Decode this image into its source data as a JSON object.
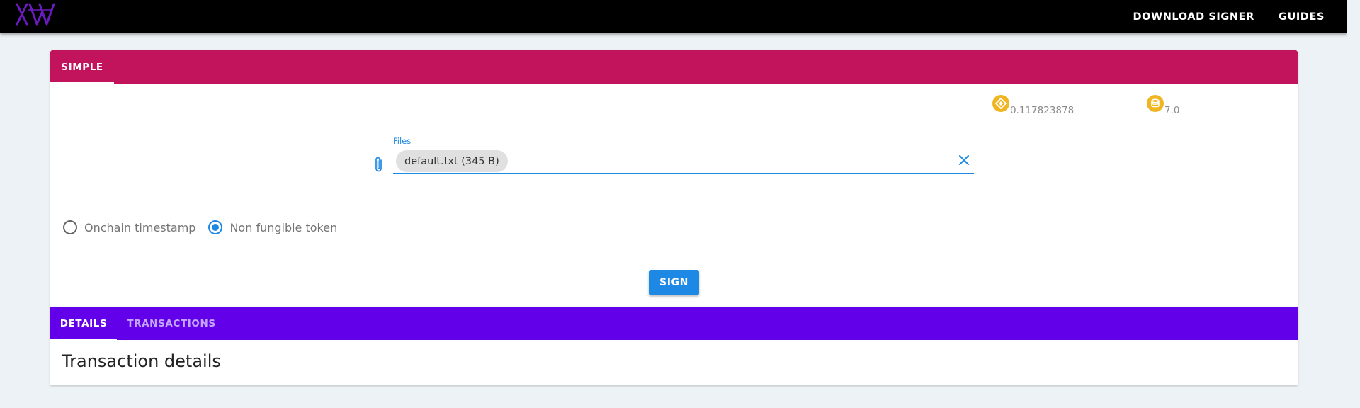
{
  "header": {
    "logo_text": "XV",
    "nav": {
      "download_signer": "DOWNLOAD SIGNER",
      "guides": "GUIDES"
    }
  },
  "top_card": {
    "tab_simple": "SIMPLE",
    "balances": [
      {
        "icon": "coin-diamond-icon",
        "value": "0.117823878"
      },
      {
        "icon": "coin-stack-icon",
        "value": "7.0"
      }
    ],
    "files": {
      "label": "Files",
      "chip": "default.txt (345 B)"
    },
    "radios": {
      "onchain": "Onchain timestamp",
      "nft": "Non fungible token",
      "selected": "nft"
    },
    "sign_button": "SIGN"
  },
  "bottom_card": {
    "tab_details": "DETAILS",
    "tab_transactions": "TRANSACTIONS",
    "section_title": "Transaction details"
  },
  "colors": {
    "accent_pink": "#c2135d",
    "accent_purple": "#6200ea",
    "primary_blue": "#1e88e5",
    "coin_gold": "#f0b622"
  }
}
